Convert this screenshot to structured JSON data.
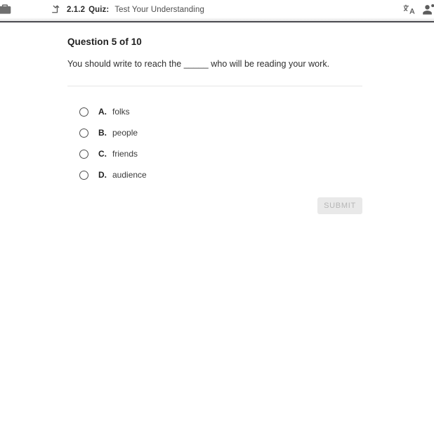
{
  "topbar": {
    "brand_icon": "briefcase-icon",
    "uplevel_icon": "up-level-arrow-icon",
    "breadcrumb": {
      "number": "2.1.2",
      "kind": "Quiz:",
      "title": "Test Your Understanding"
    },
    "actions": [
      {
        "icon": "translate-icon",
        "name": "translate-button"
      },
      {
        "icon": "account-notification-icon",
        "name": "account-button"
      }
    ]
  },
  "quiz": {
    "heading": "Question 5 of 10",
    "question": "You should write to reach the _____ who will be reading your work.",
    "options": [
      {
        "letter": "A.",
        "label": "folks",
        "selected": false
      },
      {
        "letter": "B.",
        "label": "people",
        "selected": false
      },
      {
        "letter": "C.",
        "label": "friends",
        "selected": false
      },
      {
        "letter": "D.",
        "label": "audience",
        "selected": false
      }
    ],
    "submit_label": "SUBMIT",
    "submit_enabled": false
  },
  "colors": {
    "page_background": "#ffffff",
    "header_rule": "#4a4a4f",
    "divider": "#e6e6e6",
    "submit_background": "#e9e9e9",
    "submit_text": "#b6b6b6",
    "text_primary": "#1f1f1f",
    "icon_grey": "#5c5c5c"
  }
}
